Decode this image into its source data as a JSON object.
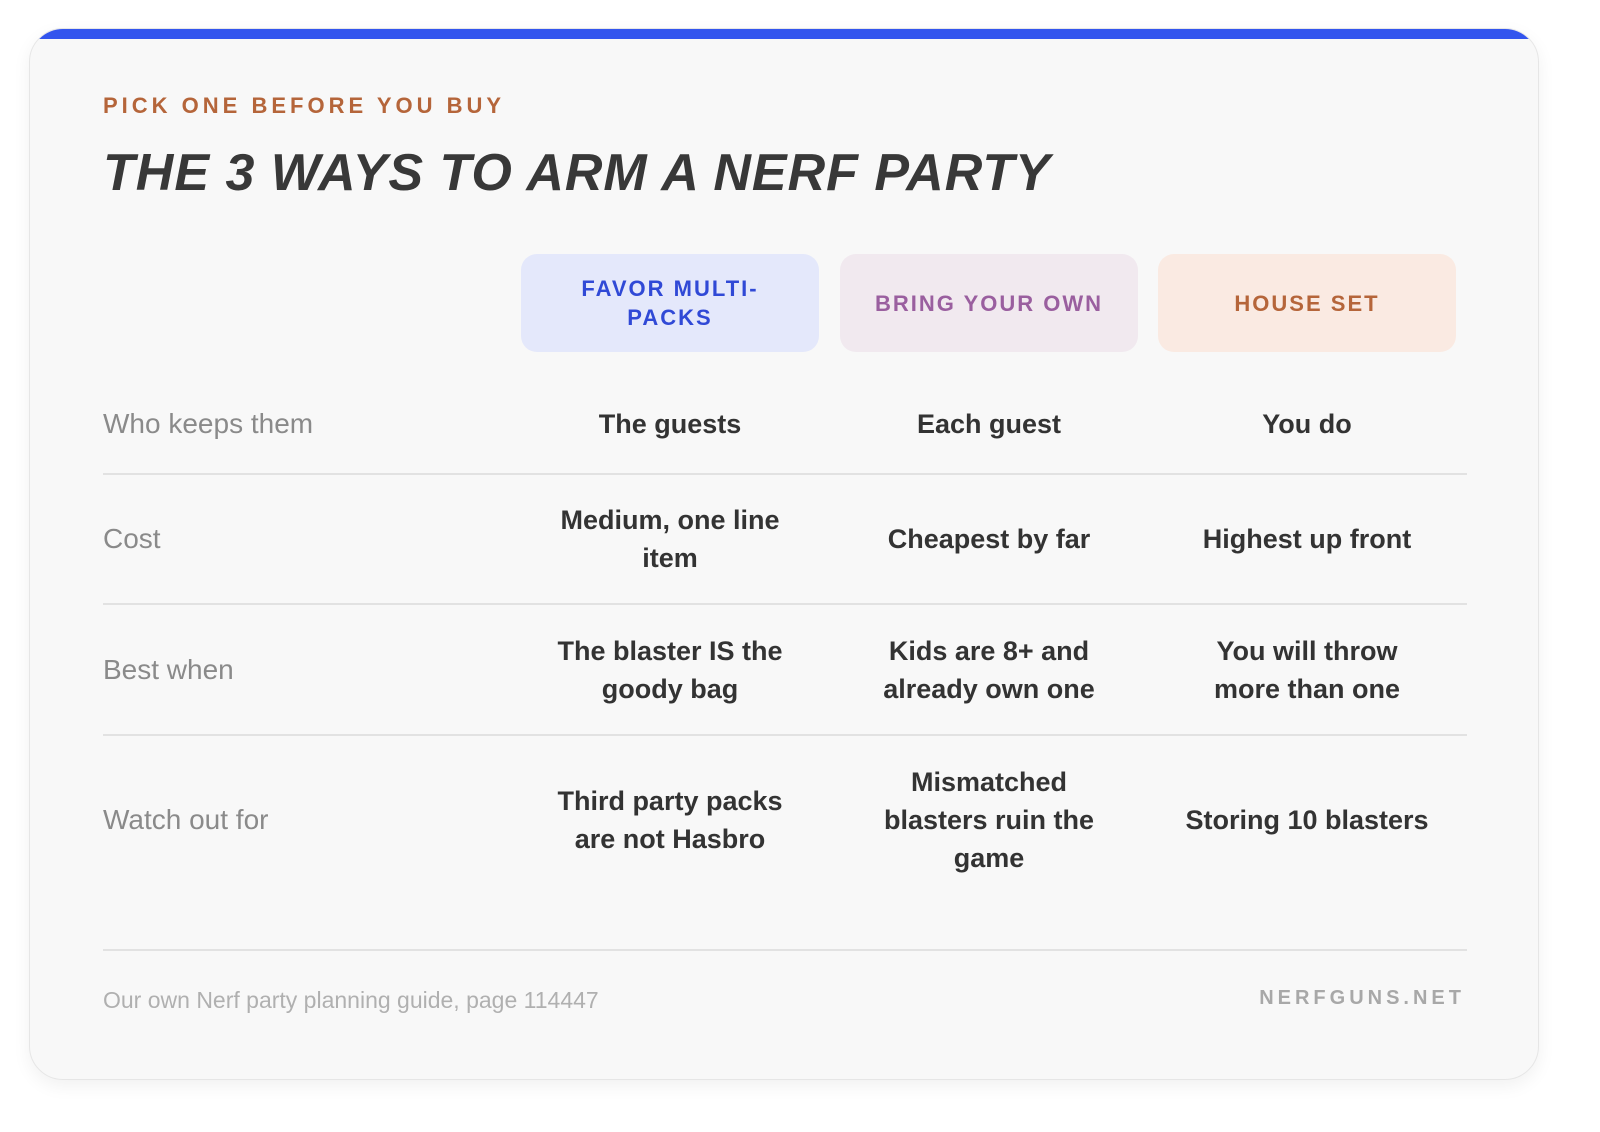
{
  "kicker": "PICK ONE BEFORE YOU BUY",
  "title": "THE 3 WAYS TO ARM A NERF PARTY",
  "columns": [
    {
      "label": "FAVOR MULTI-PACKS",
      "bg": "#e4e8fb",
      "color": "#3049d6"
    },
    {
      "label": "BRING YOUR OWN",
      "bg": "#f1e9ef",
      "color": "#9a5f9f"
    },
    {
      "label": "HOUSE SET",
      "bg": "#faeae2",
      "color": "#b5653a"
    }
  ],
  "rows": [
    {
      "label": "Who keeps them",
      "cells": [
        "The guests",
        "Each guest",
        "You do"
      ]
    },
    {
      "label": "Cost",
      "cells": [
        "Medium, one line item",
        "Cheapest by far",
        "Highest up front"
      ]
    },
    {
      "label": "Best when",
      "cells": [
        "The blaster IS the goody bag",
        "Kids are 8+ and already own one",
        "You will throw more than one"
      ]
    },
    {
      "label": "Watch out for",
      "cells": [
        "Third party packs are not Hasbro",
        "Mismatched blasters ruin the game",
        "Storing 10 blasters"
      ]
    }
  ],
  "footer": {
    "note": "Our own Nerf party planning guide, page 114447",
    "brand": "NERFGUNS.NET"
  },
  "colors": {
    "accent": "#3355ee",
    "kicker": "#b5653a"
  }
}
